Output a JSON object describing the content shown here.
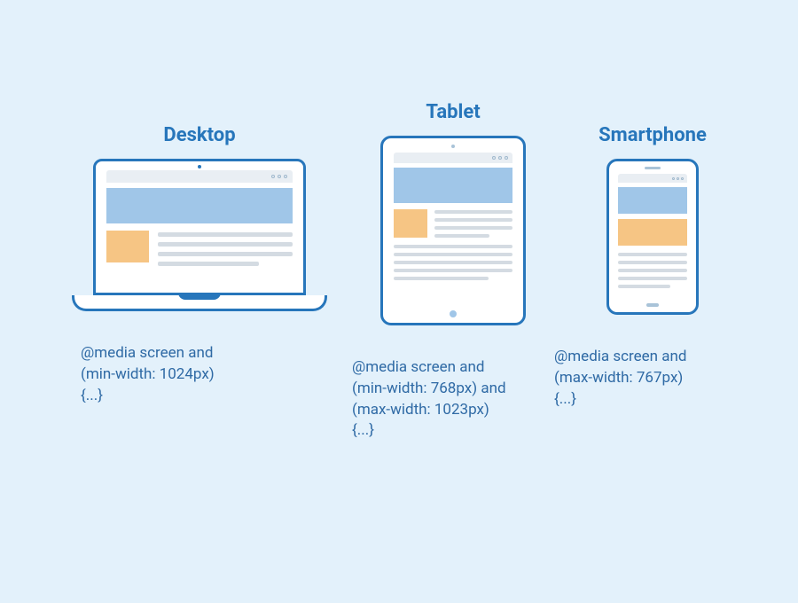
{
  "devices": {
    "desktop": {
      "title": "Desktop",
      "media_query": "@media screen and\n(min-width: 1024px)\n{...}"
    },
    "tablet": {
      "title": "Tablet",
      "media_query": "@media screen and\n(min-width: 768px) and\n(max-width: 1023px)\n{...}"
    },
    "smartphone": {
      "title": "Smartphone",
      "media_query": "@media screen and\n(max-width: 767px)\n{...}"
    }
  },
  "breakpoints": {
    "desktop_min": 1024,
    "tablet_min": 768,
    "tablet_max": 1023,
    "phone_max": 767
  },
  "colors": {
    "bg": "#e3f1fb",
    "stroke": "#2776bb",
    "hero": "#a0c6e8",
    "accent": "#f6c584",
    "muted": "#d4dbe2"
  }
}
